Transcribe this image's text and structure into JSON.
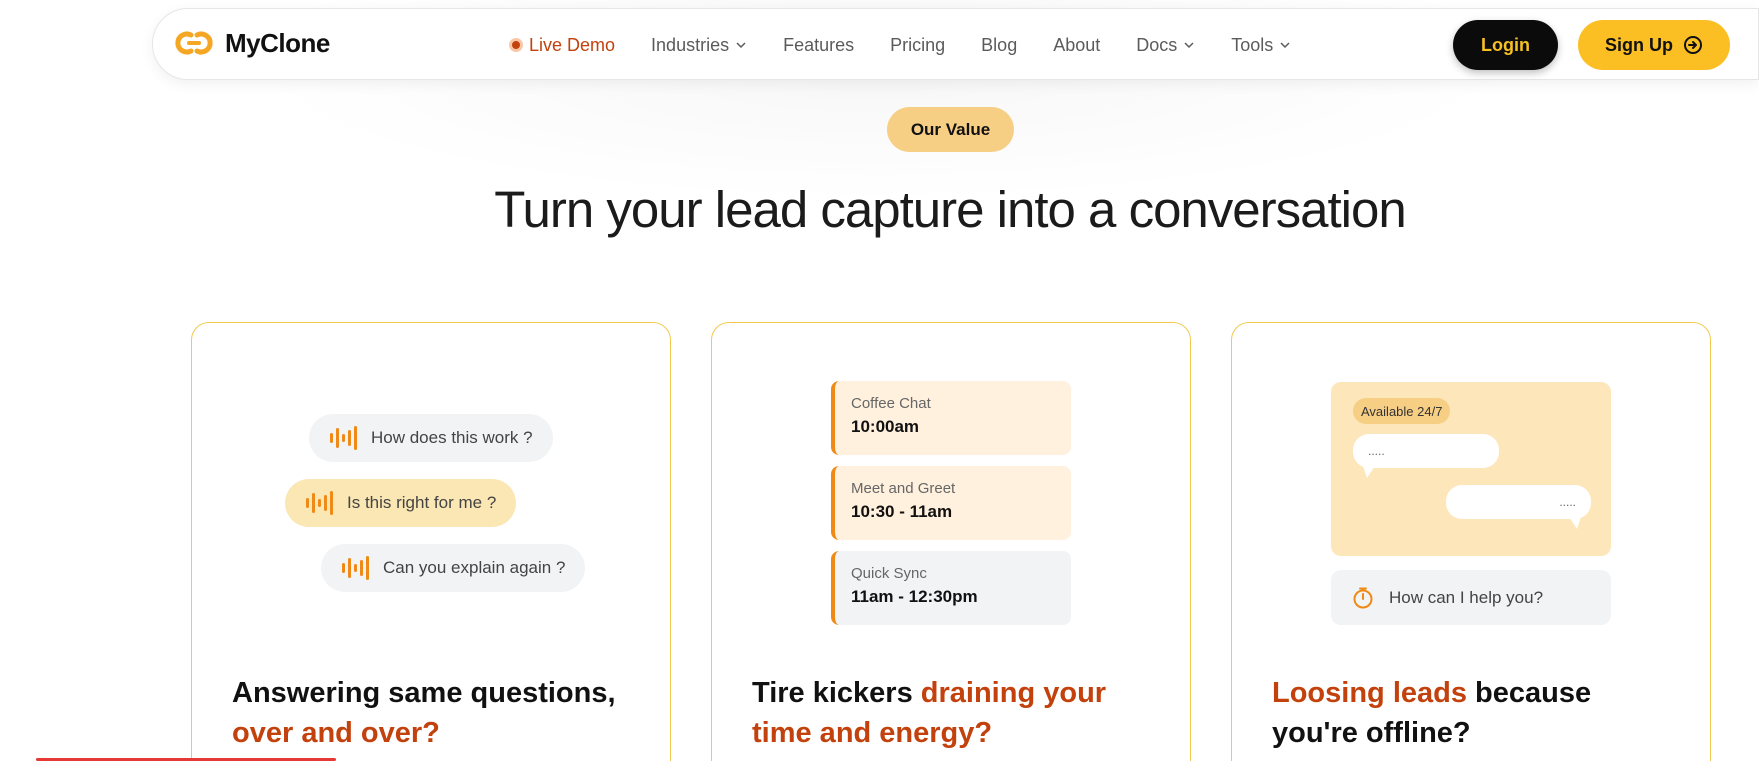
{
  "brand": {
    "name": "MyClone",
    "accent": "#fbbf24",
    "accent_dark": "#c2410c"
  },
  "nav": {
    "live_demo": "Live Demo",
    "items": [
      {
        "label": "Industries",
        "has_dropdown": true
      },
      {
        "label": "Features",
        "has_dropdown": false
      },
      {
        "label": "Pricing",
        "has_dropdown": false
      },
      {
        "label": "Blog",
        "has_dropdown": false
      },
      {
        "label": "About",
        "has_dropdown": false
      },
      {
        "label": "Docs",
        "has_dropdown": true
      },
      {
        "label": "Tools",
        "has_dropdown": true
      }
    ],
    "login": "Login",
    "signup": "Sign Up"
  },
  "section": {
    "badge": "Our Value",
    "headline": "Turn your lead capture into a conversation"
  },
  "cards": [
    {
      "questions": [
        "How does this work ?",
        "Is this right for me ?",
        "Can you explain again ?"
      ],
      "title_plain": "Answering same questions,",
      "title_accent": "over and over?"
    },
    {
      "slots": [
        {
          "label": "Coffee Chat",
          "time": "10:00am"
        },
        {
          "label": "Meet and Greet",
          "time": "10:30 - 11am"
        },
        {
          "label": "Quick Sync",
          "time": "11am - 12:30pm"
        }
      ],
      "title_plain": "Tire kickers",
      "title_accent": "draining your time and energy?"
    },
    {
      "availability": "Available 24/7",
      "bubble_left": ".....",
      "bubble_right": ".....",
      "help_prompt": "How can I help you?",
      "title_accent": "Loosing leads",
      "title_plain": "because you're offline?"
    }
  ]
}
